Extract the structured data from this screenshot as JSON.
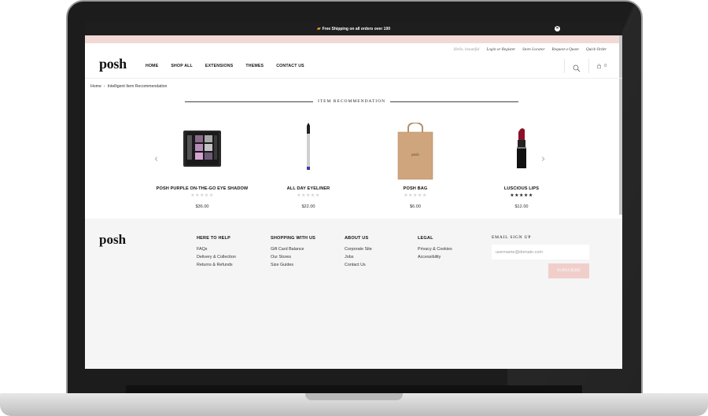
{
  "announcement": {
    "text": "Free Shipping on all orders over 100"
  },
  "utility_links": {
    "greeting": "Hello, beautiful",
    "login": "Login or Register",
    "store_locator": "Store Locator",
    "quote": "Request a Quote",
    "quick_order": "Quick Order"
  },
  "header": {
    "logo": "posh",
    "nav": [
      "HOME",
      "SHOP ALL",
      "EXTENSIONS",
      "THEMES",
      "CONTACT US"
    ],
    "cart_count": "0"
  },
  "breadcrumb": {
    "home": "Home",
    "separator": "›",
    "current": "Intelligent Item Recommendation"
  },
  "section": {
    "title": "ITEM RECOMMENDATION"
  },
  "products": [
    {
      "name": "POSH PURPLE ON-THE-GO EYE SHADOW",
      "price": "$36.00",
      "rating": 0
    },
    {
      "name": "ALL DAY EYELINER",
      "price": "$22.00",
      "rating": 0
    },
    {
      "name": "POSH BAG",
      "price": "$6.00",
      "rating": 0
    },
    {
      "name": "LUSCIOUS LIPS",
      "price": "$12.00",
      "rating": 4.5
    }
  ],
  "footer": {
    "logo": "posh",
    "columns": [
      {
        "heading": "HERE TO HELP",
        "items": [
          "FAQs",
          "Delivery & Collection",
          "Returns & Refunds"
        ]
      },
      {
        "heading": "SHOPPING WITH US",
        "items": [
          "Gift Card Balance",
          "Our Stores",
          "Size Guides"
        ]
      },
      {
        "heading": "ABOUT US",
        "items": [
          "Corporate Site",
          "Jobs",
          "Contact Us"
        ]
      },
      {
        "heading": "LEGAL",
        "items": [
          "Privacy & Cookies",
          "Accessibility"
        ]
      }
    ],
    "signup": {
      "heading": "EMAIL SIGN UP",
      "placeholder": "username@domain.com",
      "button": "SUBSCRIBE"
    }
  },
  "colors": {
    "accent_pink": "#f1d9d6",
    "button_pink": "#f0cfcb",
    "topbar": "#1e1e1e"
  }
}
